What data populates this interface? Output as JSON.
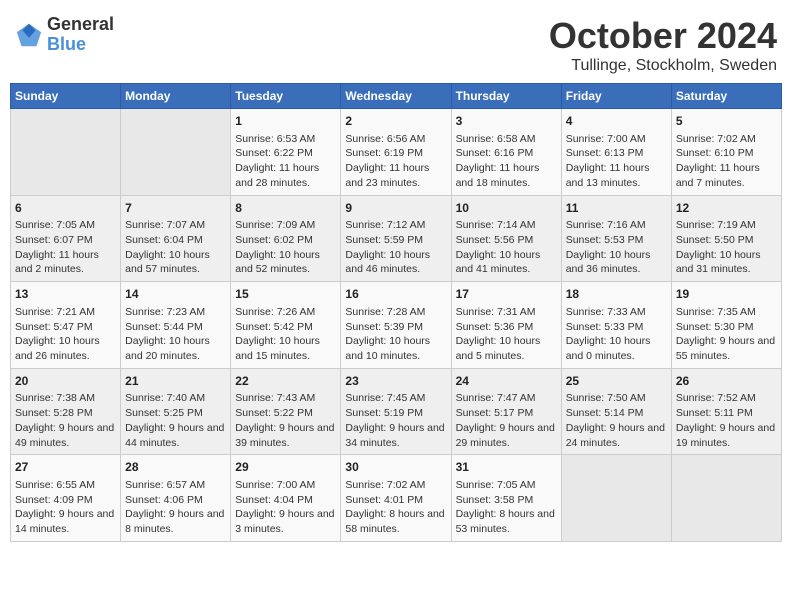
{
  "header": {
    "logo_general": "General",
    "logo_blue": "Blue",
    "title": "October 2024",
    "subtitle": "Tullinge, Stockholm, Sweden"
  },
  "weekdays": [
    "Sunday",
    "Monday",
    "Tuesday",
    "Wednesday",
    "Thursday",
    "Friday",
    "Saturday"
  ],
  "weeks": [
    [
      {
        "day": "",
        "info": ""
      },
      {
        "day": "",
        "info": ""
      },
      {
        "day": "1",
        "info": "Sunrise: 6:53 AM\nSunset: 6:22 PM\nDaylight: 11 hours and 28 minutes."
      },
      {
        "day": "2",
        "info": "Sunrise: 6:56 AM\nSunset: 6:19 PM\nDaylight: 11 hours and 23 minutes."
      },
      {
        "day": "3",
        "info": "Sunrise: 6:58 AM\nSunset: 6:16 PM\nDaylight: 11 hours and 18 minutes."
      },
      {
        "day": "4",
        "info": "Sunrise: 7:00 AM\nSunset: 6:13 PM\nDaylight: 11 hours and 13 minutes."
      },
      {
        "day": "5",
        "info": "Sunrise: 7:02 AM\nSunset: 6:10 PM\nDaylight: 11 hours and 7 minutes."
      }
    ],
    [
      {
        "day": "6",
        "info": "Sunrise: 7:05 AM\nSunset: 6:07 PM\nDaylight: 11 hours and 2 minutes."
      },
      {
        "day": "7",
        "info": "Sunrise: 7:07 AM\nSunset: 6:04 PM\nDaylight: 10 hours and 57 minutes."
      },
      {
        "day": "8",
        "info": "Sunrise: 7:09 AM\nSunset: 6:02 PM\nDaylight: 10 hours and 52 minutes."
      },
      {
        "day": "9",
        "info": "Sunrise: 7:12 AM\nSunset: 5:59 PM\nDaylight: 10 hours and 46 minutes."
      },
      {
        "day": "10",
        "info": "Sunrise: 7:14 AM\nSunset: 5:56 PM\nDaylight: 10 hours and 41 minutes."
      },
      {
        "day": "11",
        "info": "Sunrise: 7:16 AM\nSunset: 5:53 PM\nDaylight: 10 hours and 36 minutes."
      },
      {
        "day": "12",
        "info": "Sunrise: 7:19 AM\nSunset: 5:50 PM\nDaylight: 10 hours and 31 minutes."
      }
    ],
    [
      {
        "day": "13",
        "info": "Sunrise: 7:21 AM\nSunset: 5:47 PM\nDaylight: 10 hours and 26 minutes."
      },
      {
        "day": "14",
        "info": "Sunrise: 7:23 AM\nSunset: 5:44 PM\nDaylight: 10 hours and 20 minutes."
      },
      {
        "day": "15",
        "info": "Sunrise: 7:26 AM\nSunset: 5:42 PM\nDaylight: 10 hours and 15 minutes."
      },
      {
        "day": "16",
        "info": "Sunrise: 7:28 AM\nSunset: 5:39 PM\nDaylight: 10 hours and 10 minutes."
      },
      {
        "day": "17",
        "info": "Sunrise: 7:31 AM\nSunset: 5:36 PM\nDaylight: 10 hours and 5 minutes."
      },
      {
        "day": "18",
        "info": "Sunrise: 7:33 AM\nSunset: 5:33 PM\nDaylight: 10 hours and 0 minutes."
      },
      {
        "day": "19",
        "info": "Sunrise: 7:35 AM\nSunset: 5:30 PM\nDaylight: 9 hours and 55 minutes."
      }
    ],
    [
      {
        "day": "20",
        "info": "Sunrise: 7:38 AM\nSunset: 5:28 PM\nDaylight: 9 hours and 49 minutes."
      },
      {
        "day": "21",
        "info": "Sunrise: 7:40 AM\nSunset: 5:25 PM\nDaylight: 9 hours and 44 minutes."
      },
      {
        "day": "22",
        "info": "Sunrise: 7:43 AM\nSunset: 5:22 PM\nDaylight: 9 hours and 39 minutes."
      },
      {
        "day": "23",
        "info": "Sunrise: 7:45 AM\nSunset: 5:19 PM\nDaylight: 9 hours and 34 minutes."
      },
      {
        "day": "24",
        "info": "Sunrise: 7:47 AM\nSunset: 5:17 PM\nDaylight: 9 hours and 29 minutes."
      },
      {
        "day": "25",
        "info": "Sunrise: 7:50 AM\nSunset: 5:14 PM\nDaylight: 9 hours and 24 minutes."
      },
      {
        "day": "26",
        "info": "Sunrise: 7:52 AM\nSunset: 5:11 PM\nDaylight: 9 hours and 19 minutes."
      }
    ],
    [
      {
        "day": "27",
        "info": "Sunrise: 6:55 AM\nSunset: 4:09 PM\nDaylight: 9 hours and 14 minutes."
      },
      {
        "day": "28",
        "info": "Sunrise: 6:57 AM\nSunset: 4:06 PM\nDaylight: 9 hours and 8 minutes."
      },
      {
        "day": "29",
        "info": "Sunrise: 7:00 AM\nSunset: 4:04 PM\nDaylight: 9 hours and 3 minutes."
      },
      {
        "day": "30",
        "info": "Sunrise: 7:02 AM\nSunset: 4:01 PM\nDaylight: 8 hours and 58 minutes."
      },
      {
        "day": "31",
        "info": "Sunrise: 7:05 AM\nSunset: 3:58 PM\nDaylight: 8 hours and 53 minutes."
      },
      {
        "day": "",
        "info": ""
      },
      {
        "day": "",
        "info": ""
      }
    ]
  ]
}
